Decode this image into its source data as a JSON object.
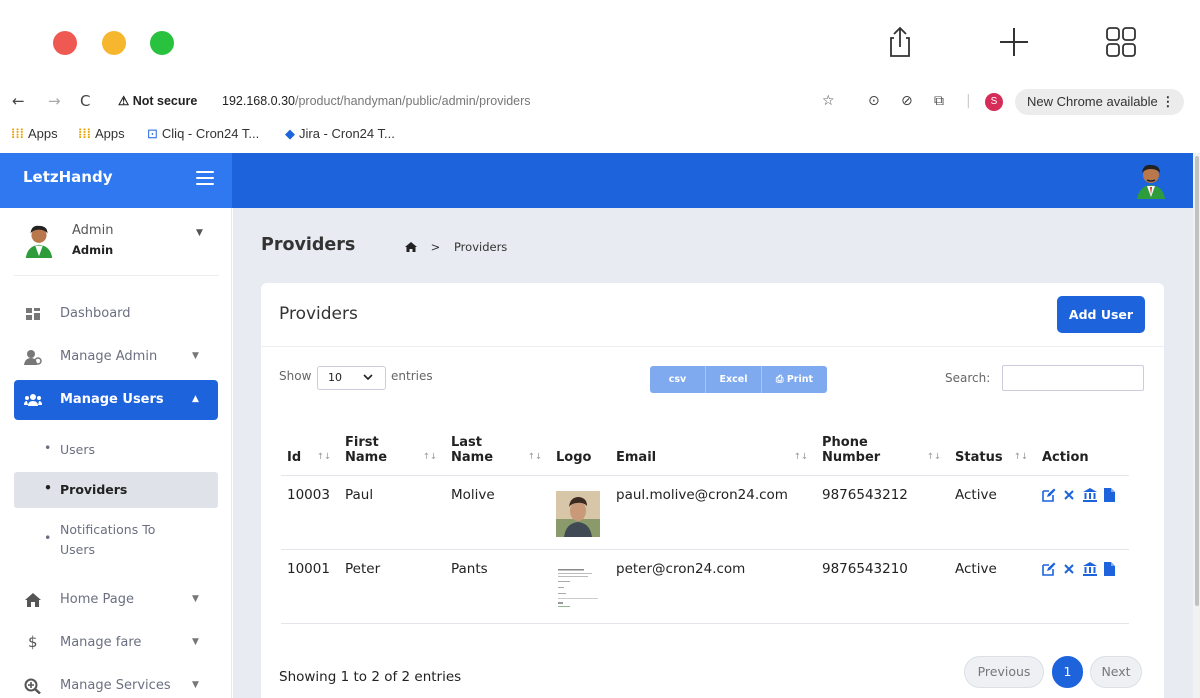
{
  "browser": {
    "not_secure": "Not secure",
    "url_host": "192.168.0.30",
    "url_path": "/product/handyman/public/admin/providers",
    "profile_initial": "S",
    "chrome_available": "New Chrome available"
  },
  "bookmarks": [
    {
      "label": "Apps"
    },
    {
      "label": "Apps"
    },
    {
      "label": "Cliq - Cron24 T..."
    },
    {
      "label": "Jira - Cron24 T..."
    }
  ],
  "app": {
    "brand": "LetzHandy",
    "accent": "#1d63dc"
  },
  "sidebar": {
    "user_name": "Admin",
    "user_role": "Admin",
    "items": [
      {
        "label": "Dashboard",
        "icon": "dashboard-icon"
      },
      {
        "label": "Manage Admin",
        "icon": "admin-icon"
      },
      {
        "label": "Manage Users",
        "icon": "users-icon"
      },
      {
        "label": "Home Page",
        "icon": "home-icon"
      },
      {
        "label": "Manage fare",
        "icon": "dollar-icon"
      },
      {
        "label": "Manage Services",
        "icon": "search-plus-icon"
      }
    ],
    "sub_items": [
      {
        "label": "Users"
      },
      {
        "label": "Providers"
      },
      {
        "label": "Notifications To Users"
      }
    ]
  },
  "page": {
    "title": "Providers",
    "breadcrumb": "Providers"
  },
  "card": {
    "title": "Providers",
    "add_user": "Add User",
    "show_label": "Show",
    "entries_value": "10",
    "entries_label": "entries",
    "export_csv": "csv",
    "export_excel": "Excel",
    "export_print": "Print",
    "search_label": "Search:",
    "search_value": "",
    "columns": [
      "Id",
      "First Name",
      "Last Name",
      "Logo",
      "Email",
      "Phone Number",
      "Status",
      "Action"
    ],
    "rows": [
      {
        "id": "10003",
        "first": "Paul",
        "last": "Molive",
        "email": "paul.molive@cron24.com",
        "phone": "9876543212",
        "status": "Active"
      },
      {
        "id": "10001",
        "first": "Peter",
        "last": "Pants",
        "email": "peter@cron24.com",
        "phone": "9876543210",
        "status": "Active"
      }
    ],
    "info": "Showing 1 to 2 of 2 entries",
    "pagination": {
      "previous": "Previous",
      "current": "1",
      "next": "Next"
    }
  }
}
